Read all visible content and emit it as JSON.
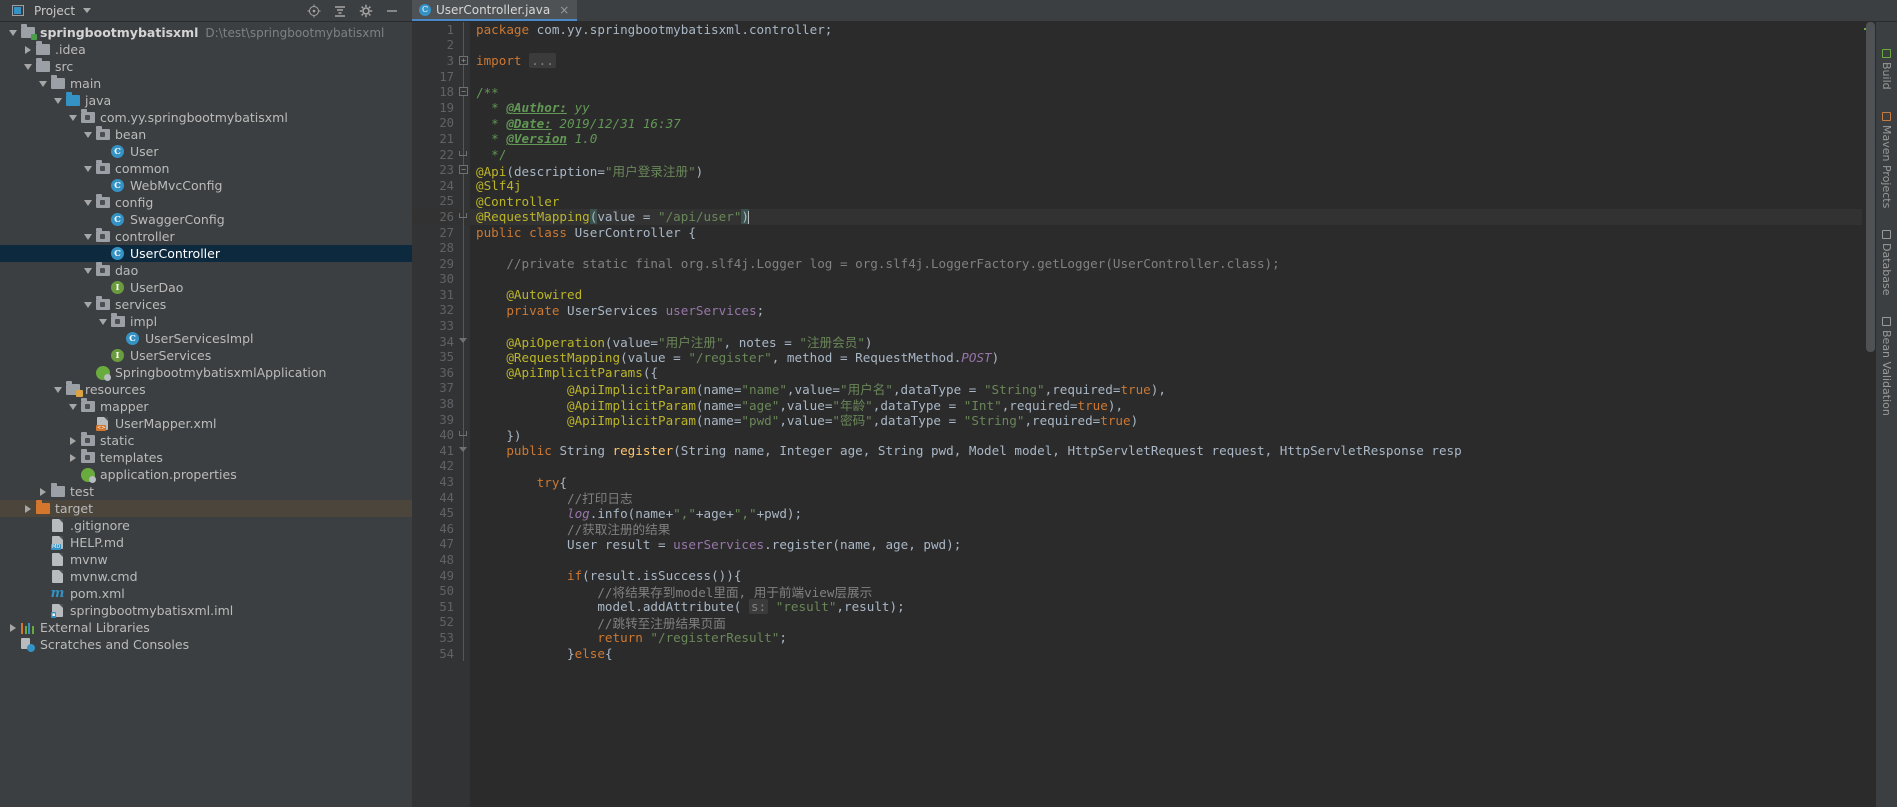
{
  "window": {
    "tool_window_title": "Project",
    "tool_buttons": [
      "locate-icon",
      "collapse-all-icon",
      "settings-icon",
      "hide-icon"
    ]
  },
  "tabs": [
    {
      "label": "UserController.java",
      "icon": "java-class-icon",
      "close": "×",
      "active": true
    }
  ],
  "tree": [
    {
      "indent": 0,
      "arrow": "open",
      "icon": "module-folder",
      "label": "springbootmybatisxml",
      "bold": true,
      "path": "D:\\test\\springbootmybatisxml"
    },
    {
      "indent": 1,
      "arrow": "closed",
      "icon": "folder",
      "label": ".idea"
    },
    {
      "indent": 1,
      "arrow": "open",
      "icon": "folder",
      "label": "src"
    },
    {
      "indent": 2,
      "arrow": "open",
      "icon": "folder",
      "label": "main"
    },
    {
      "indent": 3,
      "arrow": "open",
      "icon": "source-folder",
      "label": "java"
    },
    {
      "indent": 4,
      "arrow": "open",
      "icon": "package",
      "label": "com.yy.springbootmybatisxml"
    },
    {
      "indent": 5,
      "arrow": "open",
      "icon": "package",
      "label": "bean"
    },
    {
      "indent": 6,
      "arrow": "none",
      "icon": "class",
      "label": "User"
    },
    {
      "indent": 5,
      "arrow": "open",
      "icon": "package",
      "label": "common"
    },
    {
      "indent": 6,
      "arrow": "none",
      "icon": "class",
      "label": "WebMvcConfig"
    },
    {
      "indent": 5,
      "arrow": "open",
      "icon": "package",
      "label": "config"
    },
    {
      "indent": 6,
      "arrow": "none",
      "icon": "class",
      "label": "SwaggerConfig"
    },
    {
      "indent": 5,
      "arrow": "open",
      "icon": "package",
      "label": "controller"
    },
    {
      "indent": 6,
      "arrow": "none",
      "icon": "class",
      "label": "UserController",
      "selected": true
    },
    {
      "indent": 5,
      "arrow": "open",
      "icon": "package",
      "label": "dao"
    },
    {
      "indent": 6,
      "arrow": "none",
      "icon": "interface",
      "label": "UserDao"
    },
    {
      "indent": 5,
      "arrow": "open",
      "icon": "package",
      "label": "services"
    },
    {
      "indent": 6,
      "arrow": "open",
      "icon": "package",
      "label": "impl"
    },
    {
      "indent": 7,
      "arrow": "none",
      "icon": "class",
      "label": "UserServicesImpl"
    },
    {
      "indent": 6,
      "arrow": "none",
      "icon": "interface",
      "label": "UserServices"
    },
    {
      "indent": 5,
      "arrow": "none",
      "icon": "spring-boot",
      "label": "SpringbootmybatisxmlApplication"
    },
    {
      "indent": 3,
      "arrow": "open",
      "icon": "resource-folder",
      "label": "resources"
    },
    {
      "indent": 4,
      "arrow": "open",
      "icon": "package",
      "label": "mapper"
    },
    {
      "indent": 5,
      "arrow": "none",
      "icon": "xml-file",
      "label": "UserMapper.xml"
    },
    {
      "indent": 4,
      "arrow": "closed",
      "icon": "package",
      "label": "static"
    },
    {
      "indent": 4,
      "arrow": "closed",
      "icon": "package",
      "label": "templates"
    },
    {
      "indent": 4,
      "arrow": "none",
      "icon": "spring-leaf",
      "label": "application.properties"
    },
    {
      "indent": 2,
      "arrow": "closed",
      "icon": "folder",
      "label": "test"
    },
    {
      "indent": 1,
      "arrow": "closed",
      "icon": "excluded-folder",
      "label": "target",
      "highlighted": true
    },
    {
      "indent": 2,
      "arrow": "none",
      "icon": "text-file",
      "label": ".gitignore"
    },
    {
      "indent": 2,
      "arrow": "none",
      "icon": "md-file",
      "label": "HELP.md"
    },
    {
      "indent": 2,
      "arrow": "none",
      "icon": "text-file",
      "label": "mvnw"
    },
    {
      "indent": 2,
      "arrow": "none",
      "icon": "text-file",
      "label": "mvnw.cmd"
    },
    {
      "indent": 2,
      "arrow": "none",
      "icon": "maven-file",
      "label": "pom.xml"
    },
    {
      "indent": 2,
      "arrow": "none",
      "icon": "iml-file",
      "label": "springbootmybatisxml.iml"
    },
    {
      "indent": 0,
      "arrow": "closed",
      "icon": "libraries",
      "label": "External Libraries"
    },
    {
      "indent": 0,
      "arrow": "none",
      "icon": "scratches",
      "label": "Scratches and Consoles"
    }
  ],
  "editor": {
    "file": "UserController.java",
    "caret_line": 26,
    "lines": [
      {
        "n": 1,
        "fold": "bar",
        "html": "<span class=\"kw\">package</span> <span class=\"ctxt\">com.yy.springbootmybatisxml.controller;</span>"
      },
      {
        "n": 2,
        "fold": "bar",
        "html": ""
      },
      {
        "n": 3,
        "fold": "plus",
        "html": "<span class=\"kw\">import</span> <span class=\"foldph\">...</span>"
      },
      {
        "n": 17,
        "fold": "bar",
        "html": ""
      },
      {
        "n": 18,
        "fold": "minus",
        "html": "<span class=\"doc\">/**</span>"
      },
      {
        "n": 19,
        "fold": "bar",
        "html": "  <span class=\"doc\">* </span><span class=\"doct\">@Author:</span><span class=\"docv\"> yy</span>"
      },
      {
        "n": 20,
        "fold": "bar",
        "html": "  <span class=\"doc\">* </span><span class=\"doct\">@Date:</span><span class=\"docv\"> 2019/12/31 16:37</span>"
      },
      {
        "n": 21,
        "fold": "bar",
        "html": "  <span class=\"doc\">* </span><span class=\"doct\">@Version</span><span class=\"docv\"> 1.0</span>"
      },
      {
        "n": 22,
        "fold": "end",
        "html": "  <span class=\"doc\">*/</span>"
      },
      {
        "n": 23,
        "fold": "minus",
        "html": "<span class=\"ann\">@Api</span><span class=\"ctxt\">(</span><span class=\"ctxt\">description=</span><span class=\"str\">\"用户登录注册\"</span><span class=\"ctxt\">)</span>"
      },
      {
        "n": 24,
        "fold": "bar",
        "html": "<span class=\"ann\">@Slf4j</span>"
      },
      {
        "n": 25,
        "fold": "bar",
        "html": "<span class=\"ann\">@Controller</span>"
      },
      {
        "n": 26,
        "fold": "end",
        "caret": true,
        "html": "<span class=\"ann\">@RequestMapping</span><span class=\"brmatch\">(</span><span class=\"ctxt\">value = </span><span class=\"str\">\"/api/user\"</span><span class=\"brmatch\">)</span><span class=\"caretbar\"></span>"
      },
      {
        "n": 27,
        "fold": "bar",
        "html": "<span class=\"kw\">public class</span> <span class=\"ctxt\">UserController {</span>"
      },
      {
        "n": 28,
        "fold": "bar",
        "html": ""
      },
      {
        "n": 29,
        "fold": "bar",
        "html": "    <span class=\"cmt\">//private static final org.slf4j.Logger log = org.slf4j.LoggerFactory.getLogger(UserController.class);</span>"
      },
      {
        "n": 30,
        "fold": "bar",
        "html": ""
      },
      {
        "n": 31,
        "fold": "bar",
        "html": "    <span class=\"ann\">@Autowired</span>"
      },
      {
        "n": 32,
        "fold": "bar",
        "html": "    <span class=\"kw\">private</span> <span class=\"ctxt\">UserServices </span><span class=\"fld\">userServices</span><span class=\"ctxt\">;</span>"
      },
      {
        "n": 33,
        "fold": "bar",
        "html": ""
      },
      {
        "n": 34,
        "fold": "minus2",
        "html": "    <span class=\"ann\">@ApiOperation</span><span class=\"ctxt\">(value=</span><span class=\"str\">\"用户注册\"</span><span class=\"ctxt\">, notes = </span><span class=\"str\">\"注册会员\"</span><span class=\"ctxt\">)</span>"
      },
      {
        "n": 35,
        "fold": "bar",
        "html": "    <span class=\"ann\">@RequestMapping</span><span class=\"ctxt\">(value = </span><span class=\"str\">\"/register\"</span><span class=\"ctxt\">, method = RequestMethod.</span><span class=\"sfld\">POST</span><span class=\"ctxt\">)</span>"
      },
      {
        "n": 36,
        "fold": "bar",
        "html": "    <span class=\"ann\">@ApiImplicitParams</span><span class=\"ctxt\">({</span>"
      },
      {
        "n": 37,
        "fold": "bar",
        "html": "            <span class=\"ann\">@ApiImplicitParam</span><span class=\"ctxt\">(name=</span><span class=\"str\">\"name\"</span><span class=\"ctxt\">,value=</span><span class=\"str\">\"用户名\"</span><span class=\"ctxt\">,dataType = </span><span class=\"str\">\"String\"</span><span class=\"ctxt\">,required=</span><span class=\"kw\">true</span><span class=\"ctxt\">),</span>"
      },
      {
        "n": 38,
        "fold": "bar",
        "html": "            <span class=\"ann\">@ApiImplicitParam</span><span class=\"ctxt\">(name=</span><span class=\"str\">\"age\"</span><span class=\"ctxt\">,value=</span><span class=\"str\">\"年龄\"</span><span class=\"ctxt\">,dataType = </span><span class=\"str\">\"Int\"</span><span class=\"ctxt\">,required=</span><span class=\"kw\">true</span><span class=\"ctxt\">),</span>"
      },
      {
        "n": 39,
        "fold": "bar",
        "html": "            <span class=\"ann\">@ApiImplicitParam</span><span class=\"ctxt\">(name=</span><span class=\"str\">\"pwd\"</span><span class=\"ctxt\">,value=</span><span class=\"str\">\"密码\"</span><span class=\"ctxt\">,dataType = </span><span class=\"str\">\"String\"</span><span class=\"ctxt\">,required=</span><span class=\"kw\">true</span><span class=\"ctxt\">)</span>"
      },
      {
        "n": 40,
        "fold": "end",
        "html": "    <span class=\"ctxt\">})</span>"
      },
      {
        "n": 41,
        "fold": "minus2",
        "html": "    <span class=\"kw\">public</span> <span class=\"ctxt\">String </span><span class=\"sm\">register</span><span class=\"ctxt\">(String name, Integer age, String pwd, Model model, HttpServletRequest request, HttpServletResponse resp</span>"
      },
      {
        "n": 42,
        "fold": "bar",
        "html": ""
      },
      {
        "n": 43,
        "fold": "bar",
        "html": "        <span class=\"kw\">try</span><span class=\"ctxt\">{</span>"
      },
      {
        "n": 44,
        "fold": "bar",
        "html": "            <span class=\"cmt\">//打印日志</span>"
      },
      {
        "n": 45,
        "fold": "bar",
        "html": "            <span class=\"sfld\">log</span><span class=\"ctxt\">.info(name+</span><span class=\"str\">\",\"</span><span class=\"ctxt\">+age+</span><span class=\"str\">\",\"</span><span class=\"ctxt\">+pwd);</span>"
      },
      {
        "n": 46,
        "fold": "bar",
        "html": "            <span class=\"cmt\">//获取注册的结果</span>"
      },
      {
        "n": 47,
        "fold": "bar",
        "html": "            <span class=\"ctxt\">User result = </span><span class=\"fld\">userServices</span><span class=\"ctxt\">.register(name, age, pwd);</span>"
      },
      {
        "n": 48,
        "fold": "bar",
        "html": ""
      },
      {
        "n": 49,
        "fold": "bar",
        "html": "            <span class=\"kw\">if</span><span class=\"ctxt\">(result.isSuccess()){</span>"
      },
      {
        "n": 50,
        "fold": "bar",
        "html": "                <span class=\"cmt\">//将结果存到model里面, 用于前端view层展示</span>"
      },
      {
        "n": 51,
        "fold": "bar",
        "html": "                <span class=\"ctxt\">model.addAttribute( </span><span class=\"foldph\">s:</span><span class=\"ctxt\"> </span><span class=\"str\">\"result\"</span><span class=\"ctxt\">,result);</span>"
      },
      {
        "n": 52,
        "fold": "bar",
        "html": "                <span class=\"cmt\">//跳转至注册结果页面</span>"
      },
      {
        "n": 53,
        "fold": "bar",
        "html": "                <span class=\"kw\">return</span> <span class=\"str\">\"/registerResult\"</span><span class=\"ctxt\">;</span>"
      },
      {
        "n": 54,
        "fold": "bar",
        "html": "            <span class=\"ctxt\">}</span><span class=\"kw\">else</span><span class=\"ctxt\">{</span>"
      }
    ]
  },
  "right_toolbar": [
    {
      "label": "Build",
      "icon": "build-icon"
    },
    {
      "label": "Maven Projects",
      "icon": "maven-icon"
    },
    {
      "label": "Database",
      "icon": "database-icon"
    },
    {
      "label": "Bean Validation",
      "icon": "bean-validation-icon"
    }
  ],
  "colors": {
    "editor_bg": "#2b2b2b",
    "panel_bg": "#3c3f41",
    "gutter_bg": "#313335",
    "selection": "#0d293e",
    "accent": "#4a88c7",
    "keyword": "#cc7832",
    "string": "#6a8759",
    "annotation": "#bbb529",
    "comment": "#808080",
    "field": "#9876aa",
    "method": "#ffc66d",
    "javadoc": "#629755"
  }
}
